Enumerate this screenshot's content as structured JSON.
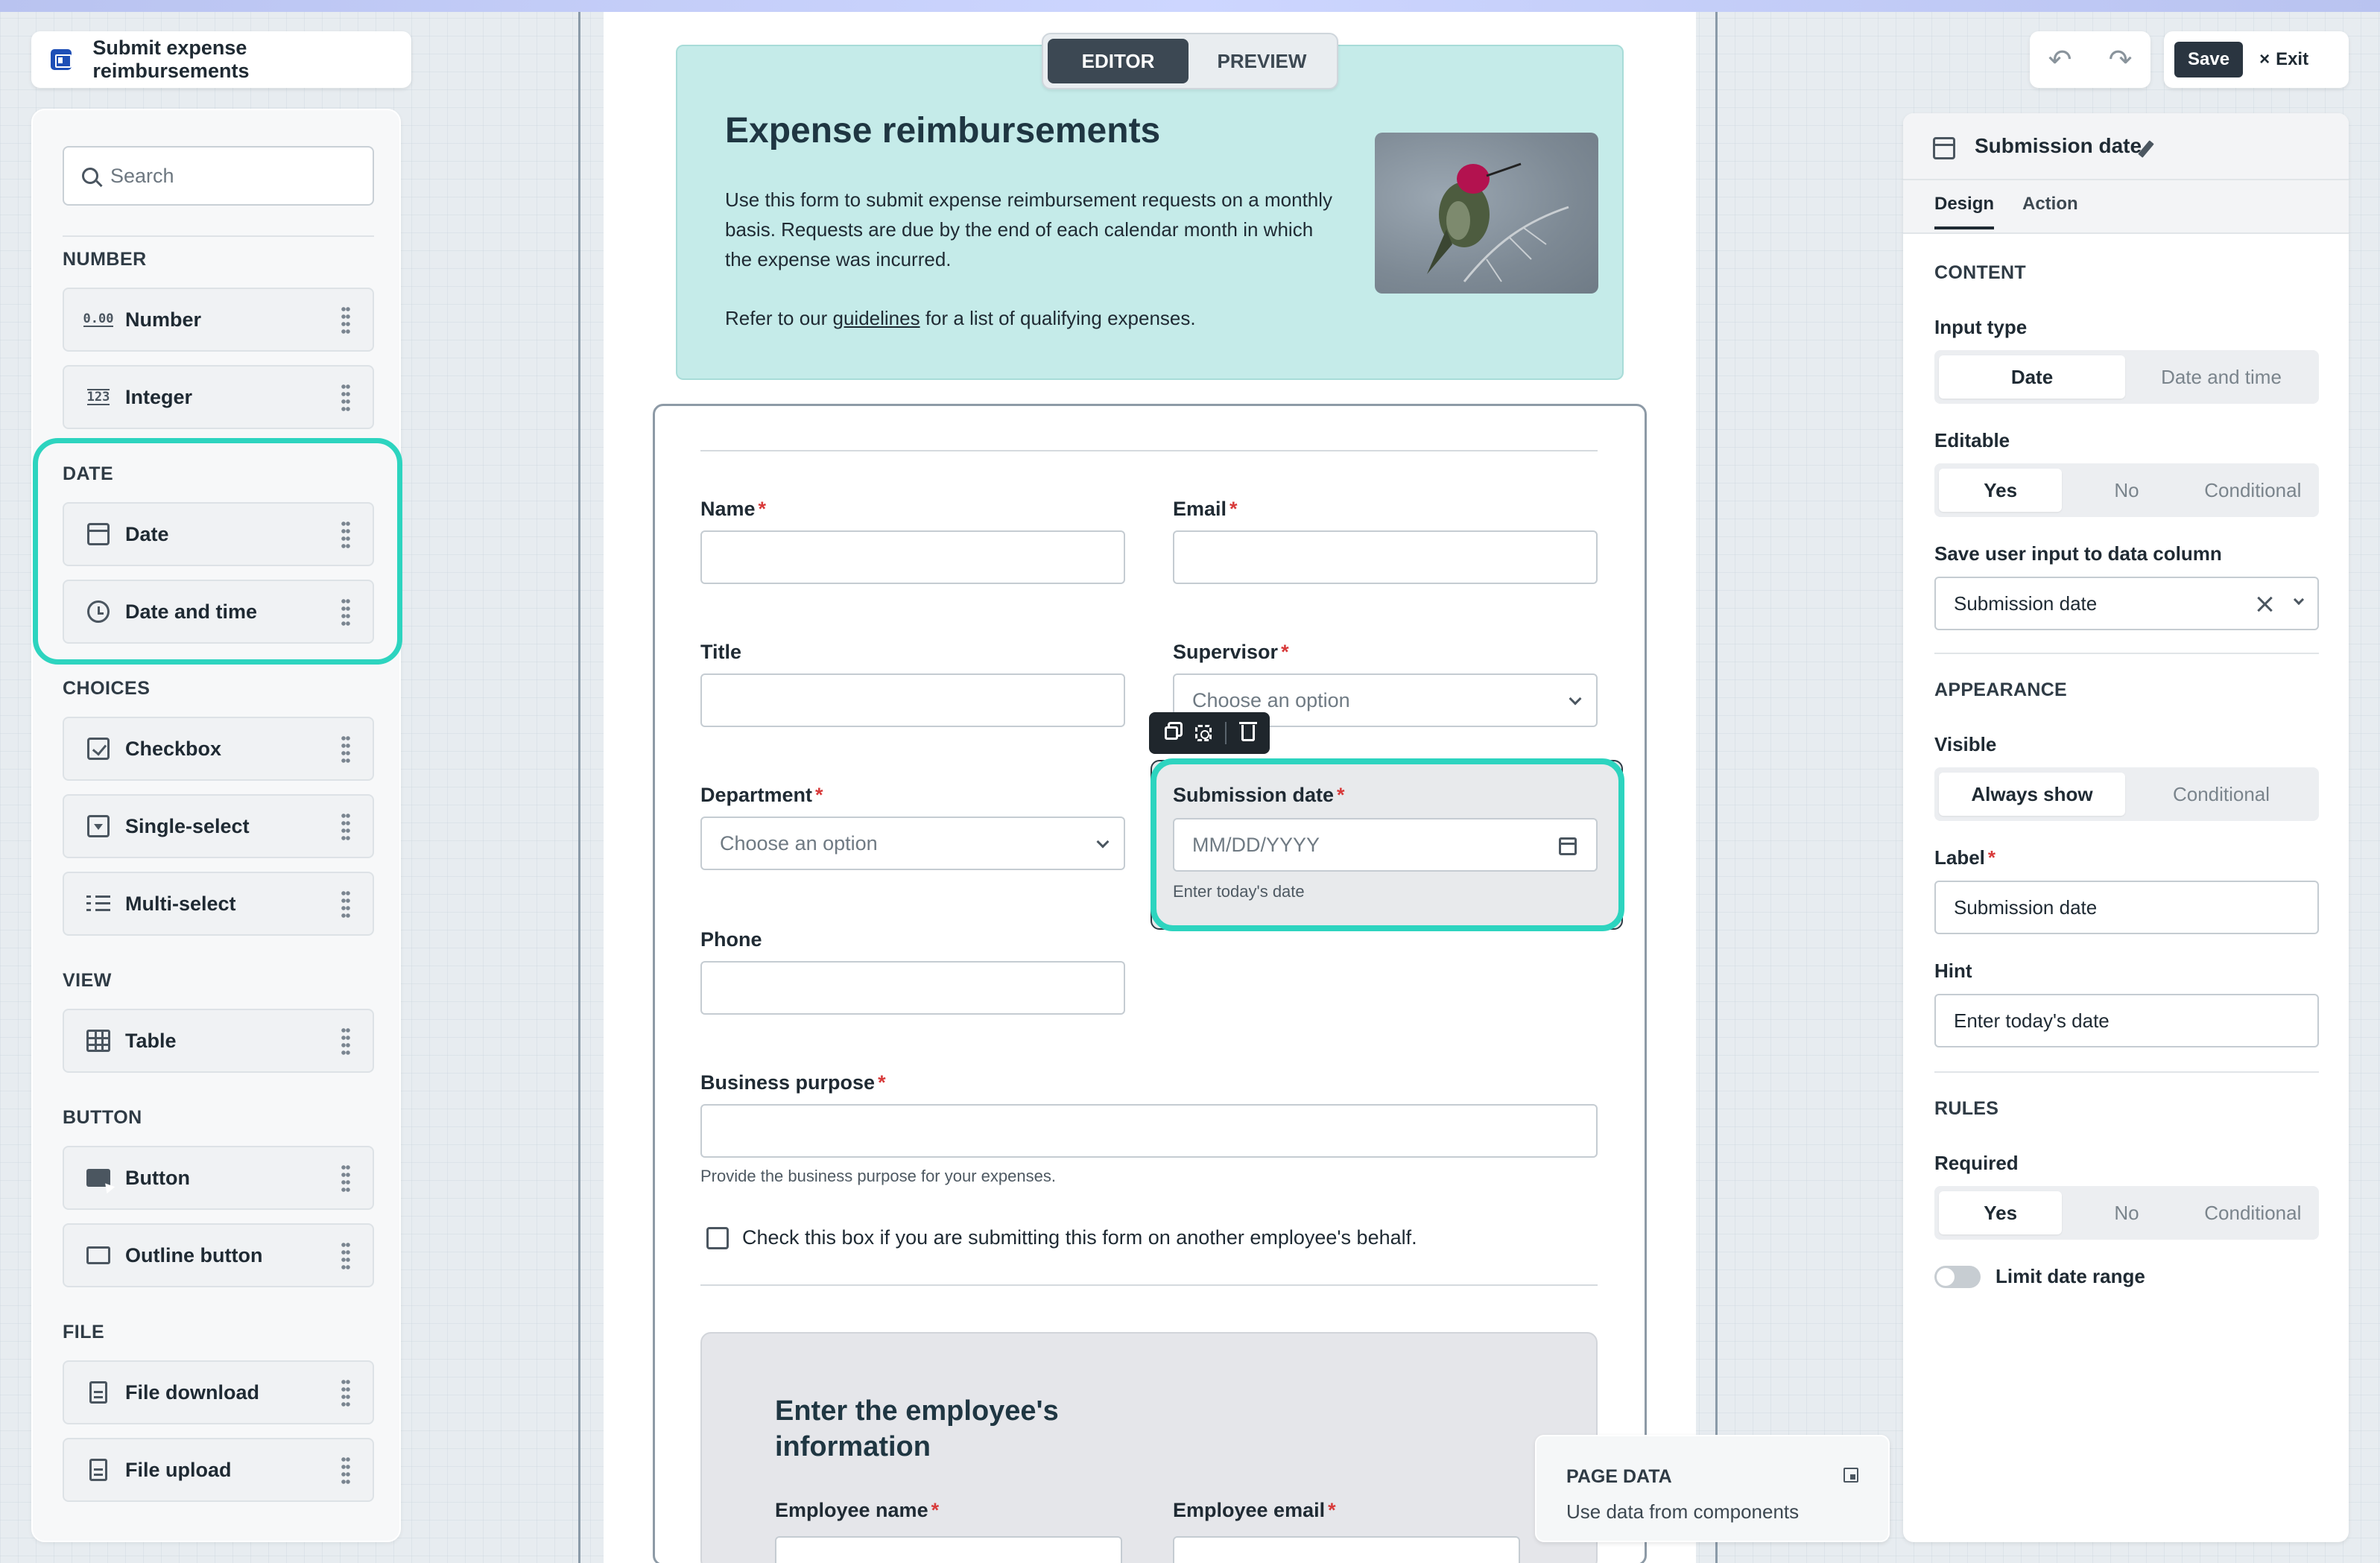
{
  "app": {
    "title": "Submit expense reimbursements"
  },
  "left_panel": {
    "search_placeholder": "Search",
    "categories": [
      {
        "label": "NUMBER",
        "items": [
          {
            "label": "Number",
            "icon": "number-icon"
          },
          {
            "label": "Integer",
            "icon": "integer-icon"
          }
        ]
      },
      {
        "label": "DATE",
        "items": [
          {
            "label": "Date",
            "icon": "calendar-icon"
          },
          {
            "label": "Date and time",
            "icon": "clock-icon"
          }
        ]
      },
      {
        "label": "CHOICES",
        "items": [
          {
            "label": "Checkbox",
            "icon": "checkbox-icon"
          },
          {
            "label": "Single-select",
            "icon": "single-select-icon"
          },
          {
            "label": "Multi-select",
            "icon": "multi-select-icon"
          }
        ]
      },
      {
        "label": "VIEW",
        "items": [
          {
            "label": "Table",
            "icon": "table-icon"
          }
        ]
      },
      {
        "label": "BUTTON",
        "items": [
          {
            "label": "Button",
            "icon": "button-icon"
          },
          {
            "label": "Outline button",
            "icon": "outline-button-icon"
          }
        ]
      },
      {
        "label": "FILE",
        "items": [
          {
            "label": "File download",
            "icon": "file-download-icon"
          },
          {
            "label": "File upload",
            "icon": "file-upload-icon"
          }
        ]
      }
    ],
    "number_icon_text": "0.00",
    "integer_icon_text": "123"
  },
  "mode_toggle": {
    "editor": "EDITOR",
    "preview": "PREVIEW",
    "active": "editor"
  },
  "banner": {
    "title": "Expense reimbursements",
    "paragraph": "Use this form to submit expense reimbursement requests on a monthly basis. Requests are due by the end of each calendar month in which the expense was incurred.",
    "refer_prefix": "Refer to our ",
    "refer_link": "guidelines",
    "refer_suffix": " for a list of qualifying expenses."
  },
  "form": {
    "name_label": "Name",
    "email_label": "Email",
    "title_label": "Title",
    "supervisor_label": "Supervisor",
    "supervisor_placeholder": "Choose an option",
    "department_label": "Department",
    "department_placeholder": "Choose an option",
    "submission_date_label": "Submission date",
    "submission_date_placeholder": "MM/DD/YYYY",
    "submission_date_hint": "Enter today's date",
    "phone_label": "Phone",
    "business_purpose_label": "Business purpose",
    "business_purpose_hint": "Provide the business purpose for your expenses.",
    "behalf_checkbox_label": "Check this box if you are submitting this form on another employee's behalf.",
    "required_mark": "*",
    "group_title": "Enter the employee's information",
    "employee_name_label": "Employee name",
    "employee_email_label": "Employee email"
  },
  "page_data_panel": {
    "title": "PAGE DATA",
    "subtitle": "Use data from components"
  },
  "toolbar": {
    "undo": "↶",
    "redo": "↷",
    "save_label": "Save",
    "exit_label": "Exit",
    "exit_icon": "×"
  },
  "inspector": {
    "title": "Submission date",
    "tabs": [
      "Design",
      "Action"
    ],
    "active_tab": "Design",
    "content_section": "CONTENT",
    "input_type_label": "Input type",
    "input_type_options": [
      "Date",
      "Date and time"
    ],
    "input_type_selected": "Date",
    "editable_label": "Editable",
    "editable_options": [
      "Yes",
      "No",
      "Conditional"
    ],
    "editable_selected": "Yes",
    "save_column_label": "Save user input to data column",
    "save_column_value": "Submission date",
    "appearance_section": "APPEARANCE",
    "visible_label": "Visible",
    "visible_options": [
      "Always show",
      "Conditional"
    ],
    "visible_selected": "Always show",
    "label_label": "Label",
    "label_value": "Submission date",
    "hint_label": "Hint",
    "hint_value": "Enter today's date",
    "rules_section": "RULES",
    "required_label": "Required",
    "required_options": [
      "Yes",
      "No",
      "Conditional"
    ],
    "required_selected": "Yes",
    "limit_date_range_label": "Limit date range",
    "limit_date_range_on": false
  },
  "colors": {
    "accent_highlight": "#2dd4bf",
    "banner_bg": "#c5ebe9",
    "dark_button": "#2a3540",
    "required": "#d83a3a"
  }
}
